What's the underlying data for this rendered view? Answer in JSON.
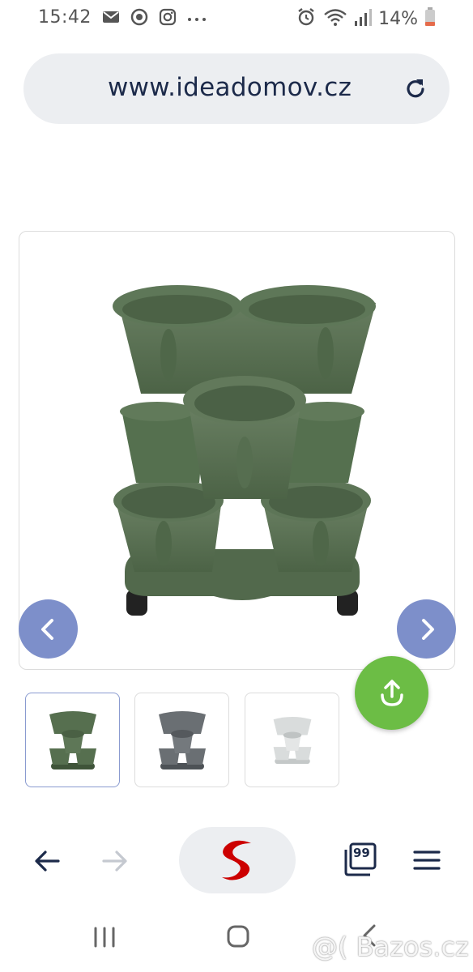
{
  "status_bar": {
    "time": "15:42",
    "battery": "14%",
    "left_icons": [
      "gmail-icon",
      "sync-icon",
      "instagram-icon",
      "more-dots-icon"
    ],
    "right_icons": [
      "alarm-icon",
      "wifi-icon",
      "signal-icon",
      "battery-icon"
    ]
  },
  "browser": {
    "url": "www.ideadomov.cz"
  },
  "product": {
    "colors": [
      "#566f4f",
      "#6a6f73",
      "#d9dcdc"
    ],
    "accent": "#7d8fca",
    "share_color": "#6cbd45"
  },
  "toolbar": {
    "tabs_count": "99"
  },
  "watermark": "@( Bazos.cz"
}
